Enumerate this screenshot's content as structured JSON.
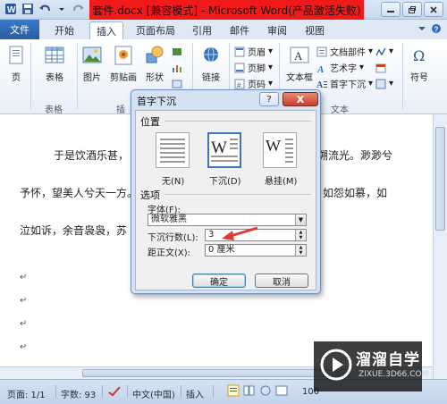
{
  "window": {
    "title": "套件.docx [兼容模式] - Microsoft Word(产品激活失败)"
  },
  "tabs": [
    {
      "label": "文件"
    },
    {
      "label": "开始"
    },
    {
      "label": "插入"
    },
    {
      "label": "页面布局"
    },
    {
      "label": "引用"
    },
    {
      "label": "邮件"
    },
    {
      "label": "审阅"
    },
    {
      "label": "视图"
    }
  ],
  "active_tab": "插入",
  "ribbon": {
    "page_label": "页",
    "table_label": "表格",
    "picture_label": "图片",
    "clipart_label": "剪贴画",
    "shapes_label": "形状",
    "link_label": "链接",
    "header_label": "页眉",
    "footer_label": "页脚",
    "pagenum_label": "页码",
    "textbox_label": "文本框",
    "docparts_label": "文档部件",
    "wordart_label": "艺术字",
    "dropcap_label": "首字下沉",
    "symbol_label": "符号",
    "group_table": "表格",
    "group_illustrations": "插",
    "group_text": "文本"
  },
  "document": {
    "line1_left": "于是饮酒乐甚，",
    "line1_right": "空明兮溯流光。渺渺兮",
    "line2_left": "予怀，望美人兮天一方。",
    "line2_right": "呜呜然，如怨如慕，如",
    "line3_left": "泣如诉，余音袅袅，苏"
  },
  "dialog": {
    "title": "首字下沉",
    "help": "?",
    "close": "X",
    "position_section": "位置",
    "options": [
      {
        "label": "无(N)"
      },
      {
        "label": "下沉(D)"
      },
      {
        "label": "悬挂(M)"
      }
    ],
    "selected_option": "下沉(D)",
    "options_section": "选项",
    "font_label": "字体(F):",
    "font_value": "微软雅黑",
    "lines_label": "下沉行数(L):",
    "lines_value": "3",
    "distance_label": "距正文(X):",
    "distance_value": "0 厘米",
    "ok": "确定",
    "cancel": "取消"
  },
  "statusbar": {
    "page": "页面: 1/1",
    "words": "字数: 93",
    "language": "中文(中国)",
    "mode": "插入",
    "zoom": "100"
  },
  "watermark": {
    "brand": "溜溜自学",
    "url": "ZIXUE.3D66.COM"
  },
  "colors": {
    "title_highlight": "#f01a1a",
    "file_tab": "#2a5da3",
    "annotation_arrow": "#e53935"
  }
}
